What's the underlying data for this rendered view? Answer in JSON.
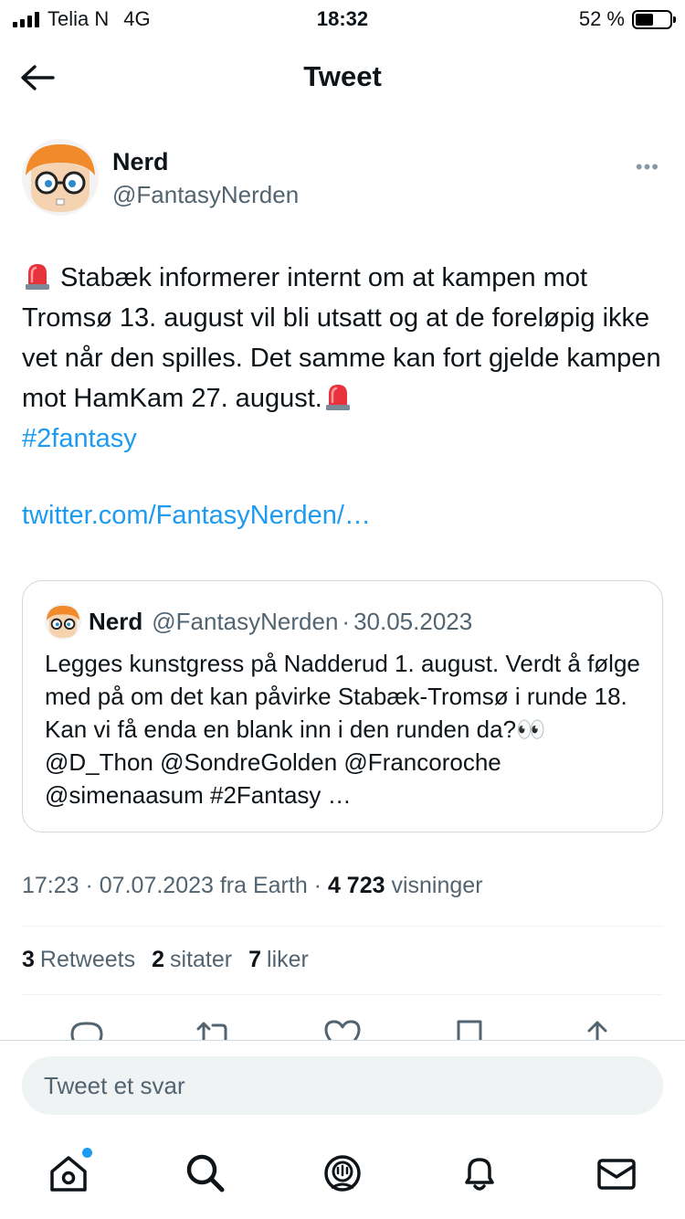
{
  "status_bar": {
    "carrier": "Telia N",
    "network": "4G",
    "time": "18:32",
    "battery": "52 %",
    "battery_level": 0.52
  },
  "header": {
    "title": "Tweet",
    "back_icon": "arrow-left-icon"
  },
  "tweet": {
    "author_name": "Nerd",
    "author_handle": "@FantasyNerden",
    "text_part1": " Stabæk informerer internt om at kampen mot Tromsø 13. august vil bli utsatt og at de foreløpig ikke vet når den spilles. Det samme kan fort gjelde kampen mot HamKam 27. august.",
    "hashtag": "#2fantasy",
    "link": "twitter.com/FantasyNerden/…",
    "emoji": "rotating-light-emoji"
  },
  "quote": {
    "author_name": "Nerd",
    "author_handle": "@FantasyNerden",
    "separator": "·",
    "date": "30.05.2023",
    "text": "Legges kunstgress på Nadderud 1. august. Verdt å følge med på om det kan påvirke Stabæk-Tromsø i runde 18. Kan vi få enda en blank inn i den runden da?👀 @D_Thon @SondreGolden @Francoroche @simenaasum #2Fantasy …"
  },
  "meta": {
    "time": "17:23",
    "date": "07.07.2023",
    "source": "fra Earth",
    "views_count": "4 723",
    "views_label": "visninger"
  },
  "stats": {
    "retweets_count": "3",
    "retweets_label": "Retweets",
    "quotes_count": "2",
    "quotes_label": "sitater",
    "likes_count": "7",
    "likes_label": "liker"
  },
  "reply": {
    "placeholder": "Tweet et svar"
  },
  "colors": {
    "accent": "#1d9bf0",
    "secondary_text": "#536471",
    "border": "#cfd9de"
  }
}
